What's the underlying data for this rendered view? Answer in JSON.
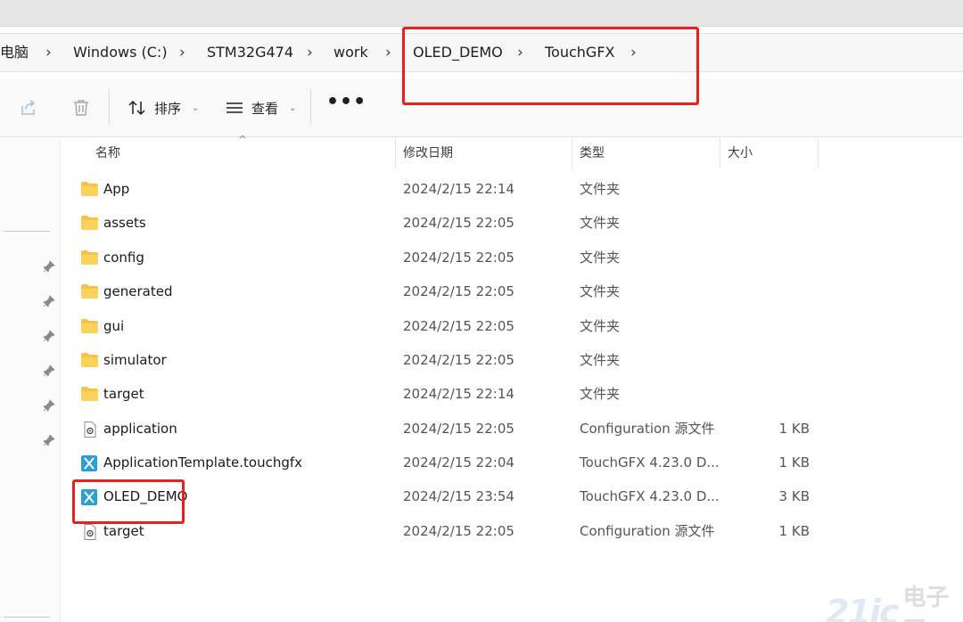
{
  "breadcrumb": {
    "items": [
      {
        "label": "电脑"
      },
      {
        "label": "Windows (C:)"
      },
      {
        "label": "STM32G474"
      },
      {
        "label": "work"
      },
      {
        "label": "OLED_DEMO"
      },
      {
        "label": "TouchGFX"
      }
    ],
    "chevron": "›"
  },
  "toolbar": {
    "share_icon": "share-icon",
    "delete_icon": "trash-icon",
    "sort_label": "排序",
    "view_label": "查看",
    "more_label": "•••",
    "caret": "⌄"
  },
  "columns": {
    "name": "名称",
    "date": "修改日期",
    "type": "类型",
    "size": "大小",
    "sort_indicator": "^"
  },
  "files": [
    {
      "name": "App",
      "date": "2024/2/15 22:14",
      "type": "文件夹",
      "size": "",
      "icon": "folder-icon"
    },
    {
      "name": "assets",
      "date": "2024/2/15 22:05",
      "type": "文件夹",
      "size": "",
      "icon": "folder-icon"
    },
    {
      "name": "config",
      "date": "2024/2/15 22:05",
      "type": "文件夹",
      "size": "",
      "icon": "folder-icon"
    },
    {
      "name": "generated",
      "date": "2024/2/15 22:05",
      "type": "文件夹",
      "size": "",
      "icon": "folder-icon"
    },
    {
      "name": "gui",
      "date": "2024/2/15 22:05",
      "type": "文件夹",
      "size": "",
      "icon": "folder-icon"
    },
    {
      "name": "simulator",
      "date": "2024/2/15 22:05",
      "type": "文件夹",
      "size": "",
      "icon": "folder-icon"
    },
    {
      "name": "target",
      "date": "2024/2/15 22:14",
      "type": "文件夹",
      "size": "",
      "icon": "folder-icon"
    },
    {
      "name": "application",
      "date": "2024/2/15 22:05",
      "type": "Configuration 源文件",
      "size": "1 KB",
      "icon": "config-file-icon"
    },
    {
      "name": "ApplicationTemplate.touchgfx",
      "date": "2024/2/15 22:04",
      "type": "TouchGFX 4.23.0 D...",
      "size": "1 KB",
      "icon": "touchgfx-file-icon"
    },
    {
      "name": "OLED_DEMO",
      "date": "2024/2/15 23:54",
      "type": "TouchGFX 4.23.0 D...",
      "size": "3 KB",
      "icon": "touchgfx-file-icon"
    },
    {
      "name": "target",
      "date": "2024/2/15 22:05",
      "type": "Configuration 源文件",
      "size": "1 KB",
      "icon": "config-file-icon"
    }
  ],
  "watermark": {
    "number": "21ic",
    "text": "电子网"
  },
  "colors": {
    "highlight": "#e8211c",
    "folder": "#f6c445",
    "touchgfx": "#2a9fd8"
  }
}
